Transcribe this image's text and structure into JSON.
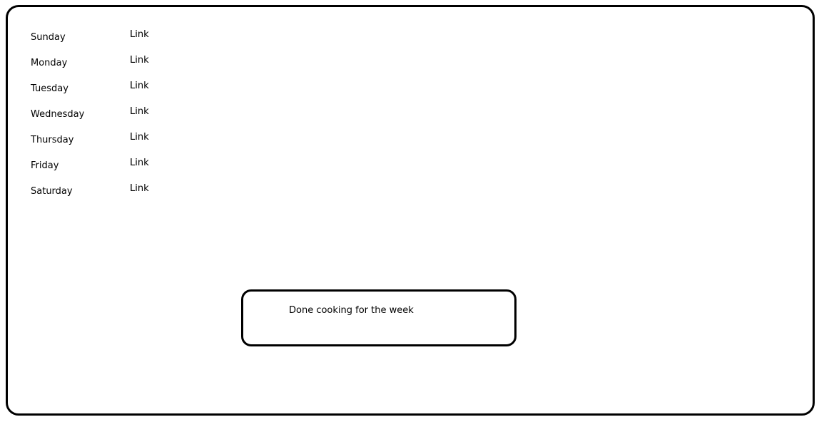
{
  "days": [
    {
      "label": "Sunday",
      "link": "Link"
    },
    {
      "label": "Monday",
      "link": "Link"
    },
    {
      "label": "Tuesday",
      "link": "Link"
    },
    {
      "label": "Wednesday",
      "link": "Link"
    },
    {
      "label": "Thursday",
      "link": "Link"
    },
    {
      "label": "Friday",
      "link": "Link"
    },
    {
      "label": "Saturday",
      "link": "Link"
    }
  ],
  "done_button": {
    "label": "Done cooking for the week"
  }
}
